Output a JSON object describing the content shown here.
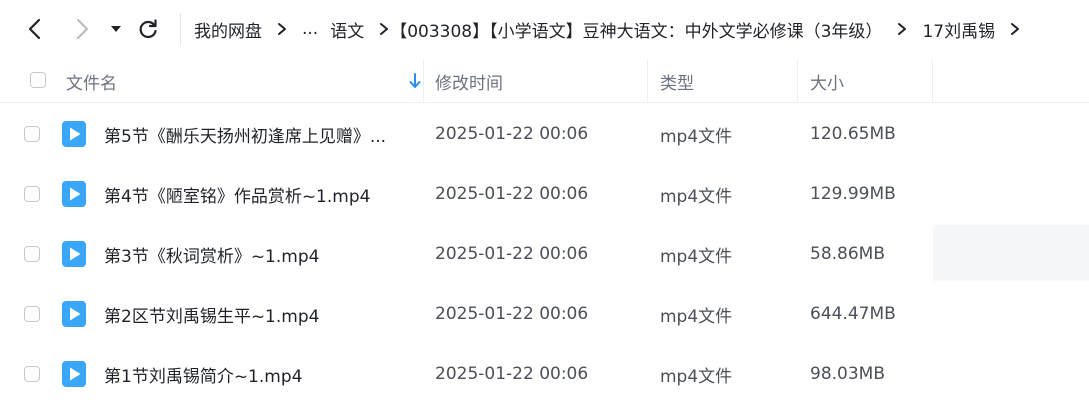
{
  "toolbar": {
    "back_icon": "chevron-left-icon",
    "forward_icon": "chevron-right-icon",
    "history_icon": "caret-down-icon",
    "refresh_icon": "refresh-icon"
  },
  "breadcrumb": {
    "root": "我的网盘",
    "ellipsis": "...",
    "items": [
      "语文",
      "【003308】【小学语文】豆神大语文：中外文学必修课（3年级）",
      "17刘禹锡"
    ]
  },
  "table": {
    "columns": {
      "name": "文件名",
      "mtime": "修改时间",
      "type": "类型",
      "size": "大小"
    },
    "sort_icon": "arrow-down-icon",
    "rows": [
      {
        "name": "第5节《酬乐天扬州初逢席上见赠》...",
        "mtime": "2025-01-22 00:06",
        "type": "mp4文件",
        "size": "120.65MB"
      },
      {
        "name": "第4节《陋室铭》作品赏析~1.mp4",
        "mtime": "2025-01-22 00:06",
        "type": "mp4文件",
        "size": "129.99MB"
      },
      {
        "name": "第3节《秋词赏析》~1.mp4",
        "mtime": "2025-01-22 00:06",
        "type": "mp4文件",
        "size": "58.86MB"
      },
      {
        "name": "第2区节刘禹锡生平~1.mp4",
        "mtime": "2025-01-22 00:06",
        "type": "mp4文件",
        "size": "644.47MB"
      },
      {
        "name": "第1节刘禹锡简介~1.mp4",
        "mtime": "2025-01-22 00:06",
        "type": "mp4文件",
        "size": "98.03MB"
      }
    ]
  },
  "colors": {
    "video_icon": "#3aa6f8",
    "text_primary": "#1f2329",
    "text_secondary": "#6b7280",
    "sort_arrow": "#2b8cf0"
  }
}
